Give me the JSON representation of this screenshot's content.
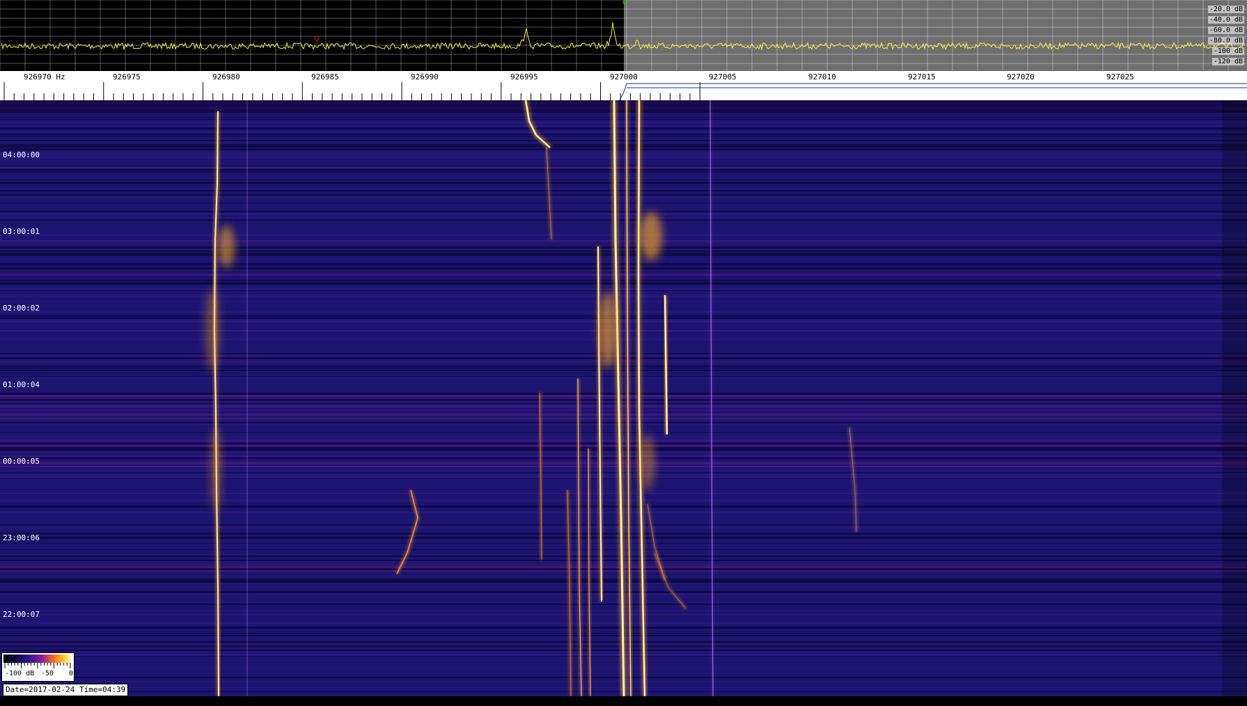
{
  "spectrum": {
    "db_labels": [
      "-20.0 dB",
      "-40.0 dB",
      "-60.0 dB",
      "-80.0 dB",
      "-100 dB",
      "-120 dB"
    ]
  },
  "ruler": {
    "freq_labels": [
      "926970 Hz",
      "926975",
      "926980",
      "926985",
      "926990",
      "926995",
      "927000",
      "927005",
      "927010",
      "927015",
      "927020",
      "927025"
    ]
  },
  "waterfall": {
    "time_labels": [
      "04:00:00",
      "03:00:01",
      "02:00:02",
      "01:00:04",
      "00:00:05",
      "23:00:06",
      "22:00:07"
    ]
  },
  "legend": {
    "min_label": "-100 dB",
    "mid_label": "-50",
    "max_label": "0"
  },
  "status": {
    "text": "Date=2017-02-24 Time=04:39"
  },
  "colors": {
    "trace": "#f2f04a",
    "waterfall_bg": "#1d1470",
    "signal_hot": "#ffb020",
    "signal_core": "#fff2a0"
  }
}
